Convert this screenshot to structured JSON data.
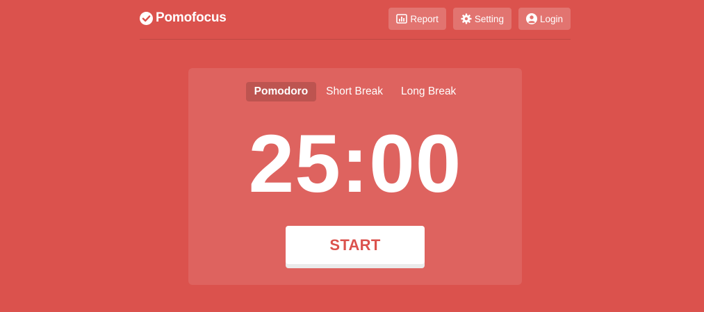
{
  "app": {
    "name": "Pomofocus",
    "logo_icon": "check-circle-icon"
  },
  "nav": {
    "report": {
      "label": "Report",
      "icon": "bar-chart-icon"
    },
    "setting": {
      "label": "Setting",
      "icon": "gear-icon"
    },
    "login": {
      "label": "Login",
      "icon": "user-circle-icon"
    }
  },
  "timer": {
    "tabs": [
      {
        "label": "Pomodoro",
        "active": true
      },
      {
        "label": "Short Break",
        "active": false
      },
      {
        "label": "Long Break",
        "active": false
      }
    ],
    "display": "25:00",
    "start_label": "START"
  },
  "colors": {
    "background": "#db524d",
    "start_text": "#db524d"
  }
}
